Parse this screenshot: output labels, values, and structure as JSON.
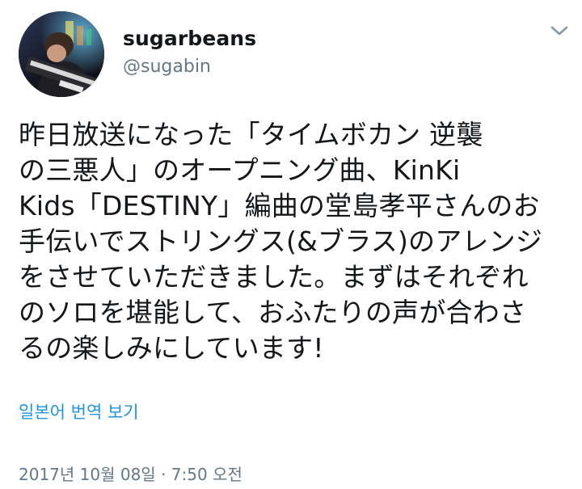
{
  "tweet": {
    "display_name": "sugarbeans",
    "handle": "@sugabin",
    "avatar_icon": "profile-photo-keyboard-player",
    "menu_icon": "chevron-down-icon",
    "text": "昨日放送になった「タイムボカン 逆襲\nの三悪人」のオープニング曲、KinKi\nKids「DESTINY」編曲の堂島孝平さんのお\n手伝いでストリングス(&ブラス)のアレンジ\nをさせていただきました。まずはそれぞれ\nのソロを堪能して、おふたりの声が合わさ\nるの楽しみにしています!",
    "translate_label": "일본어 번역 보기",
    "timestamp": "2017년 10월 08일 · 7:50 오전"
  },
  "colors": {
    "link": "#1b95e0",
    "secondary_text": "#657786",
    "primary_text": "#14171a"
  }
}
